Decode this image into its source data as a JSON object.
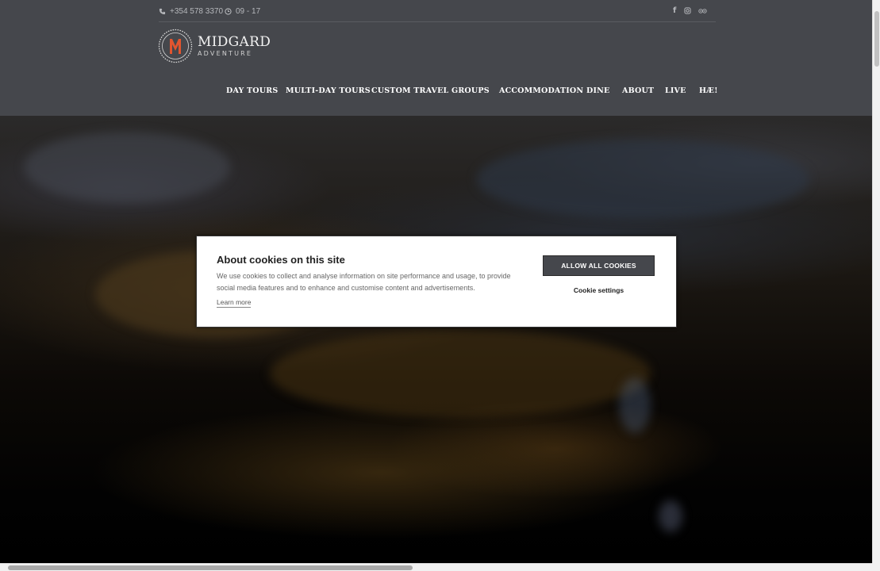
{
  "header": {
    "phone": "+354 578 3370",
    "hours": "09 - 17",
    "social": [
      "facebook-icon",
      "instagram-icon",
      "tripadvisor-icon"
    ],
    "logo": {
      "title": "MIDGARD",
      "subtitle": "ADVENTURE",
      "mark_letter": "M"
    },
    "nav": [
      {
        "label": "DAY TOURS"
      },
      {
        "label": "MULTI-DAY TOURS"
      },
      {
        "label": "CUSTOM TRAVEL"
      },
      {
        "label": "GROUPS"
      },
      {
        "label": "ACCOMMODATION"
      },
      {
        "label": "DINE"
      },
      {
        "label": "ABOUT"
      },
      {
        "label": "LIVE"
      },
      {
        "label": "HÆ!"
      }
    ]
  },
  "cookie_banner": {
    "title": "About cookies on this site",
    "text": "We use cookies to collect and analyse information on site performance and usage, to provide social media features and to enhance and customise content and advertisements.",
    "learn_more": "Learn more",
    "allow_all": "ALLOW ALL COOKIES",
    "settings": "Cookie settings"
  },
  "colors": {
    "header_bg": "#45474c",
    "logo_accent": "#e2552f",
    "button_bg": "#45474c"
  }
}
